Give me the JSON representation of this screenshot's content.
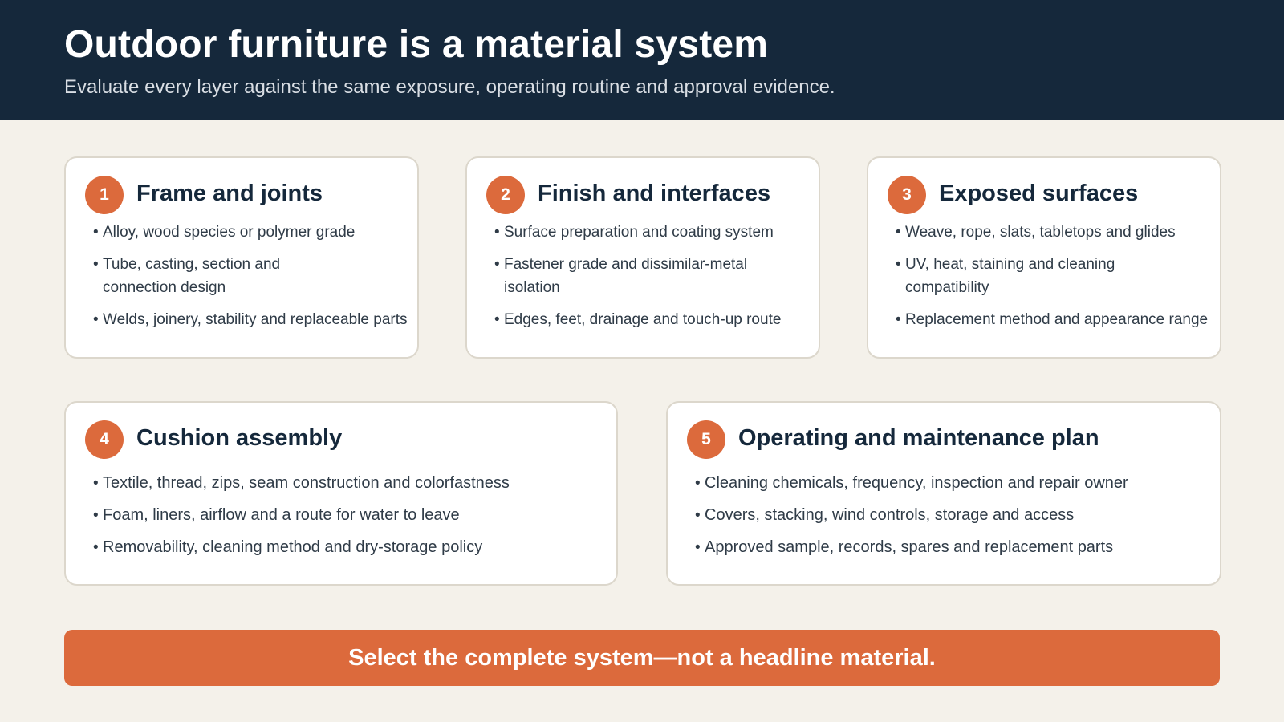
{
  "header": {
    "title": "Outdoor furniture is a material system",
    "subtitle": "Evaluate every layer against the same exposure, operating routine and approval evidence."
  },
  "cards": [
    {
      "number": "1",
      "title": "Frame and joints",
      "bullets": [
        "Alloy, wood species or polymer grade",
        "Tube, casting, section and connection design",
        "Welds, joinery, stability and replaceable parts"
      ]
    },
    {
      "number": "2",
      "title": "Finish and interfaces",
      "bullets": [
        "Surface preparation and coating system",
        "Fastener grade and dissimilar-metal isolation",
        "Edges, feet, drainage and touch-up route"
      ]
    },
    {
      "number": "3",
      "title": "Exposed surfaces",
      "bullets": [
        "Weave, rope, slats, tabletops and glides",
        "UV, heat, staining and cleaning compatibility",
        "Replacement method and appearance range"
      ]
    },
    {
      "number": "4",
      "title": "Cushion assembly",
      "bullets": [
        "Textile, thread, zips, seam construction and colorfastness",
        "Foam, liners, airflow and a route for water to leave",
        "Removability, cleaning method and dry-storage policy"
      ]
    },
    {
      "number": "5",
      "title": "Operating and maintenance plan",
      "bullets": [
        "Cleaning chemicals, frequency, inspection and repair owner",
        "Covers, stacking, wind controls, storage and access",
        "Approved sample, records, spares and replacement parts"
      ]
    }
  ],
  "banner": {
    "text": "Select the complete system—not a headline material."
  },
  "colors": {
    "header_bg": "#15283b",
    "accent": "#dc6a3c",
    "page_bg": "#f4f1ea"
  }
}
